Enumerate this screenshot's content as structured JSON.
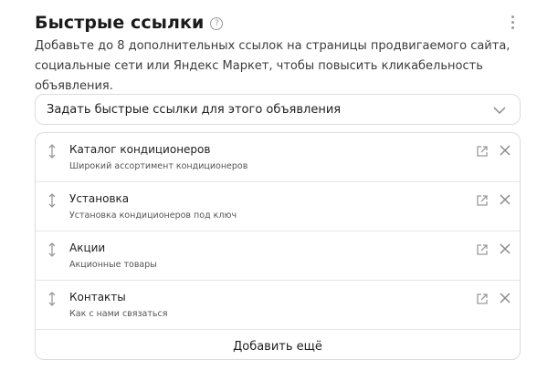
{
  "section": {
    "title": "Быстрые ссылки",
    "help_icon": "question-circle-icon",
    "menu_icon": "more-vertical-icon",
    "description": "Добавьте до 8 дополнительных ссылок на страницы продвигаемого сайта, социальные сети или Яндекс Маркет, чтобы повысить кликабельность объявления."
  },
  "select": {
    "value": "Задать быстрые ссылки для этого объявления",
    "icon": "chevron-down-icon"
  },
  "links": [
    {
      "title": "Каталог кондиционеров",
      "description": "Широкий ассортимент кондиционеров"
    },
    {
      "title": "Установка",
      "description": "Установка кондиционеров под ключ"
    },
    {
      "title": "Акции",
      "description": "Акционные товары"
    },
    {
      "title": "Контакты",
      "description": "Как с нами связаться"
    }
  ],
  "add_button": "Добавить ещё",
  "colors": {
    "text": "#1f1f1f",
    "secondary": "#555555",
    "border": "#dcdcdc",
    "icon": "#9a9a9a"
  }
}
